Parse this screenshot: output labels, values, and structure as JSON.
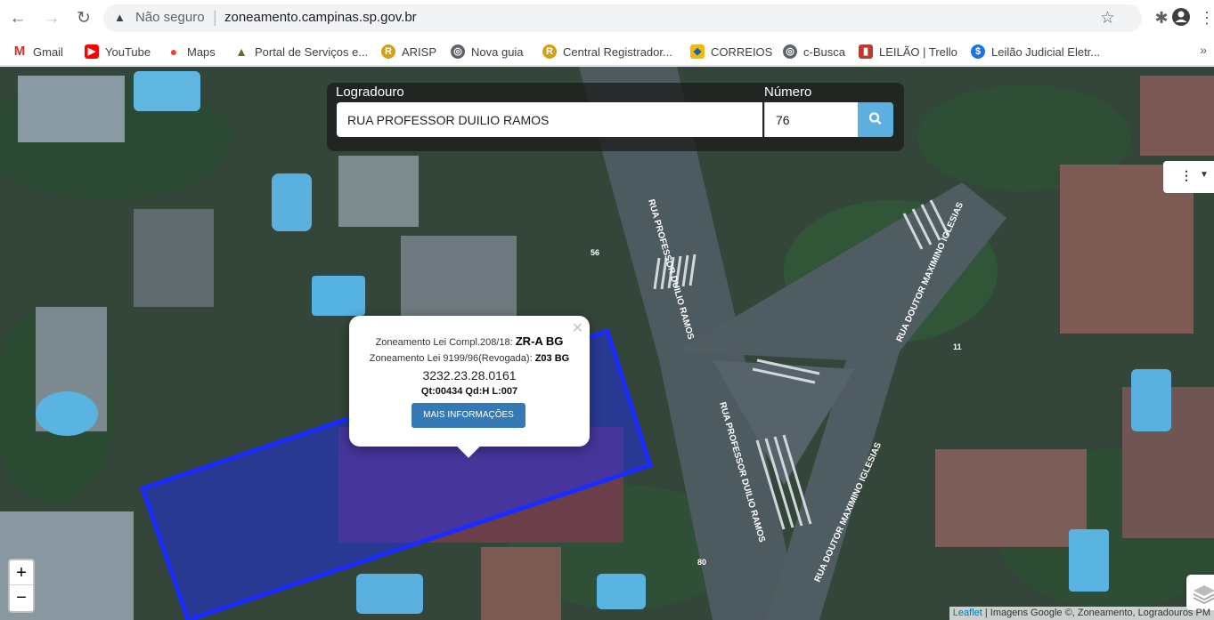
{
  "browser": {
    "security_label": "Não seguro",
    "url": "zoneamento.campinas.sp.gov.br"
  },
  "bookmarks": [
    {
      "label": "Gmail",
      "icon": "gmail-icon",
      "color": "#d93025"
    },
    {
      "label": "YouTube",
      "icon": "youtube-icon",
      "color": "#ff0000"
    },
    {
      "label": "Maps",
      "icon": "maps-icon",
      "color": "#ea4335"
    },
    {
      "label": "Portal de Serviços e...",
      "icon": "portal-icon",
      "color": "#6b6b3a"
    },
    {
      "label": "ARISP",
      "icon": "arisp-icon",
      "color": "#d4a017"
    },
    {
      "label": "Nova guia",
      "icon": "globe-icon",
      "color": "#5f6368"
    },
    {
      "label": "Central Registrador...",
      "icon": "central-icon",
      "color": "#d4a017"
    },
    {
      "label": "CORREIOS",
      "icon": "correios-icon",
      "color": "#f2b807"
    },
    {
      "label": "c-Busca",
      "icon": "globe-icon",
      "color": "#5f6368"
    },
    {
      "label": "LEILÃO | Trello",
      "icon": "trello-icon",
      "color": "#c0392b"
    },
    {
      "label": "Leilão Judicial Eletr...",
      "icon": "leilao-icon",
      "color": "#1a73e8"
    }
  ],
  "search": {
    "logradouro_label": "Logradouro",
    "logradouro_value": "RUA PROFESSOR DUILIO RAMOS",
    "numero_label": "Número",
    "numero_value": "76"
  },
  "map": {
    "street_labels": [
      "RUA PROFESSOR DUILIO RAMOS",
      "RUA DOUTOR MAXIMINO IGLESIAS",
      "RUA PROFESSOR DUILIO RAMOS",
      "RUA DOUTOR MAXIMINO IGLESIAS"
    ],
    "house_numbers": [
      "56",
      "11",
      "80"
    ],
    "parcel_color": "#1a2cff",
    "attribution_link": "Leaflet",
    "attribution_text": "| Imagens Google ©, Zoneamento, Logradouros PM"
  },
  "popup": {
    "line1_prefix": "Zoneamento Lei Compl.208/18:",
    "line1_value": "ZR-A BG",
    "line2_prefix": "Zoneamento Lei 9199/96(Revogada):",
    "line2_value": "Z03 BG",
    "code": "3232.23.28.0161",
    "lot_info": "Qt:00434 Qd:H L:007",
    "button_label": "MAIS INFORMAÇÕES"
  },
  "controls": {
    "zoom_in": "+",
    "zoom_out": "−"
  }
}
